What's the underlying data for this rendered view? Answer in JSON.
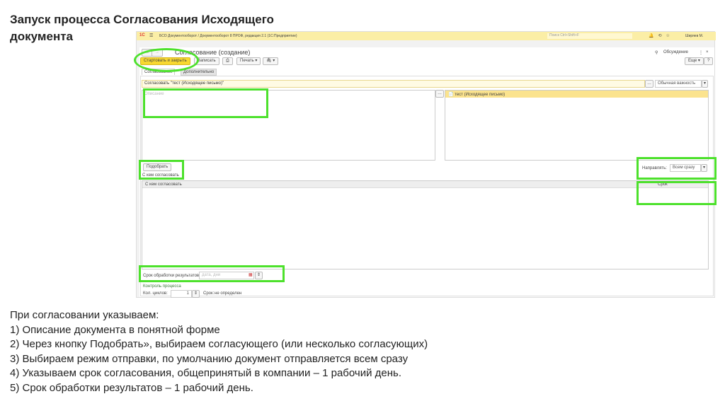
{
  "slide_title": "Запуск процесса Согласования Исходящего документа",
  "app": {
    "logo": "1С",
    "window_title": "БСО Документооборот / Документооборот 8 ПРОФ, редакция 2.1  (1С:Предприятие)",
    "search_placeholder": "Поиск Ctrl+Shift+F",
    "user": "Ширяев М.",
    "form_title": "Согласование (создание)",
    "discussions": "Обсуждение",
    "toolbar": {
      "start_close": "Стартовать и закрыть",
      "save": "Записать",
      "print": "Печать",
      "more": "Еще",
      "help": "?"
    },
    "tabs": [
      "Согласование",
      "Дополнительно"
    ],
    "subject": "Согласовать \"тест (Исходящее письмо)\"",
    "importance": "Обычная важность",
    "description_placeholder": "Описание",
    "attachment": "тест (Исходящее письмо)",
    "pick_button": "Подобрать",
    "approvers_label": "С кем согласовать",
    "direction_label": "Направлять:",
    "direction_value": "Всем сразу",
    "table_headers": [
      "С кем согласовать",
      "Срок"
    ],
    "processing_label": "Срок обработки результатов:",
    "processing_placeholder": "дата, дни",
    "control_title": "Контроль процесса",
    "cycles_label": "Кол. циклов:",
    "cycles_value": "1",
    "deadline_label": "Срок:",
    "deadline_value": "не определен"
  },
  "instructions": {
    "intro": "При согласовании указываем:",
    "items": [
      "1)   Описание документа в понятной форме",
      "2)   Через кнопку Подобрать», выбираем согласующего (или несколько согласующих)",
      "3)   Выбираем режим отправки, по умолчанию документ отправляется всем сразу",
      "4)   Указываем срок согласования, общепринятый в компании – 1 рабочий день.",
      "5)   Срок обработки результатов – 1 рабочий день."
    ]
  },
  "colors": {
    "highlight": "#4de12c",
    "accent_yellow": "#f8d830",
    "header_yellow": "#fbeea6"
  }
}
